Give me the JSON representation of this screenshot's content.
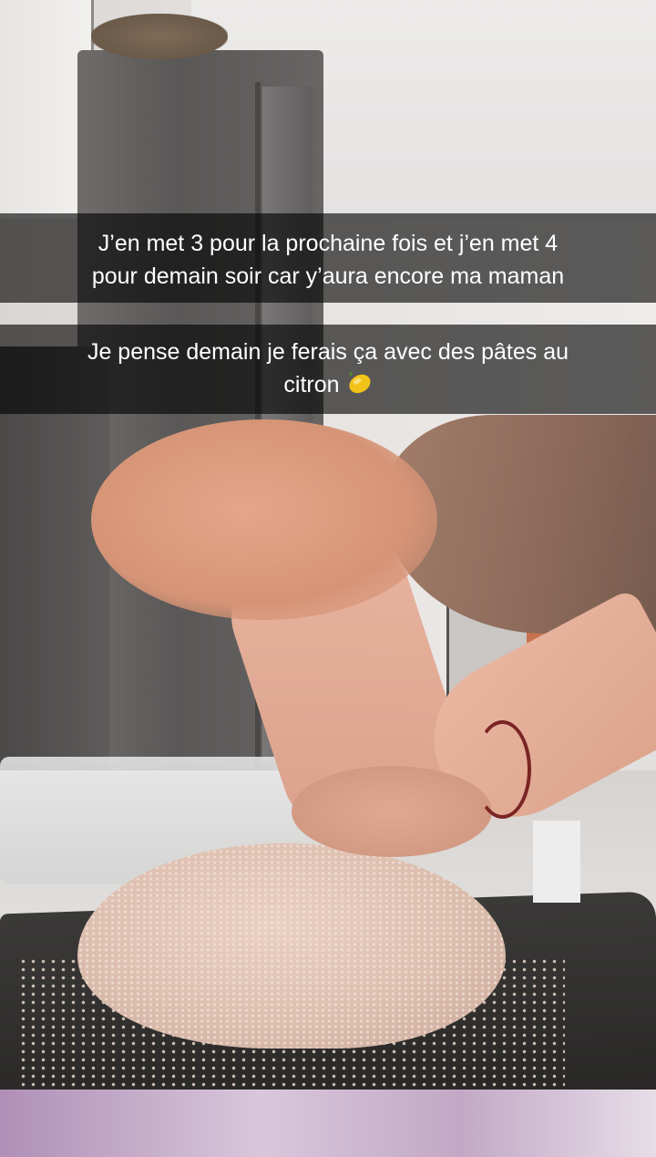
{
  "captions": [
    {
      "lines": [
        "J’en met 3 pour la prochaine fois et j’en met 4",
        "pour demain soir car y’aura encore ma maman"
      ]
    },
    {
      "lines": [
        "Je pense demain je ferais ça avec des pâtes au",
        "citron"
      ],
      "emoji": "lemon-icon"
    }
  ],
  "colors": {
    "caption_bg": "#000000",
    "caption_text": "#ffffff",
    "lemon": "#f2c318"
  }
}
